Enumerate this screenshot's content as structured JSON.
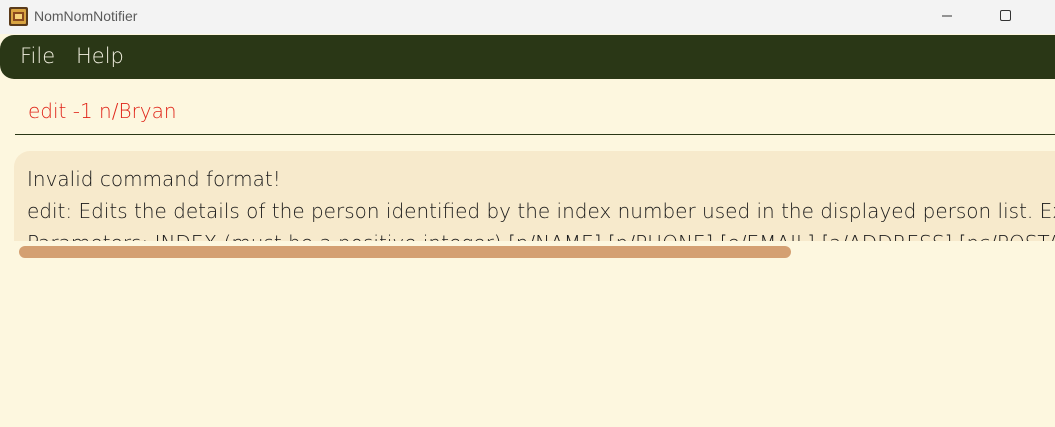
{
  "window": {
    "title": "NomNomNotifier"
  },
  "menubar": {
    "items": [
      {
        "label": "File"
      },
      {
        "label": "Help"
      }
    ]
  },
  "command_box": {
    "value": "edit -1 n/Bryan"
  },
  "result_display": {
    "lines": [
      "Invalid command format!",
      "edit: Edits the details of the person identified by the index number used in the displayed person list. Existing values will be overwritten by the input values.",
      "Parameters: INDEX (must be a positive integer) [n/NAME] [p/PHONE] [e/EMAIL] [a/ADDRESS] [pc/POSTAL_CODE]"
    ]
  },
  "colors": {
    "menubar_bg": "#2A3716",
    "page_bg": "#FDF7DF",
    "result_bg": "#F7EACC",
    "command_error_text": "#E0261A",
    "scrollbar_thumb": "#D4A072"
  }
}
